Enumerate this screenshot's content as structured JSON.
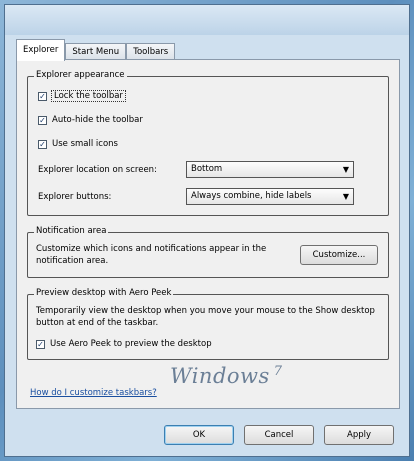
{
  "tabs": [
    {
      "label": "Explorer",
      "active": true
    },
    {
      "label": "Start Menu",
      "active": false
    },
    {
      "label": "Toolbars",
      "active": false
    }
  ],
  "group_explorer": {
    "title": "Explorer appearance",
    "options": [
      {
        "label": "Lock the toolbar",
        "checked": true
      },
      {
        "label": "Auto-hide the toolbar",
        "checked": true
      },
      {
        "label": "Use small icons",
        "checked": true
      }
    ],
    "field1": {
      "label": "Explorer location on screen:",
      "value": "Bottom"
    },
    "field2": {
      "label": "Explorer buttons:",
      "value": "Always combine, hide labels"
    }
  },
  "group_notification": {
    "title": "Notification area",
    "description": "Customize which icons and notifications appear in the notification area.",
    "button": "Customize..."
  },
  "group_peek": {
    "title": "Preview desktop with Aero Peek",
    "description": "Temporarily view the desktop when you move your mouse to the Show desktop button at end of the taskbar.",
    "option": {
      "label": "Use Aero Peek to preview the desktop",
      "checked": true
    }
  },
  "brand": {
    "text": "Windows",
    "version": "7"
  },
  "link": "How do I customize taskbars?",
  "buttons": {
    "ok": "OK",
    "cancel": "Cancel",
    "apply": "Apply"
  }
}
